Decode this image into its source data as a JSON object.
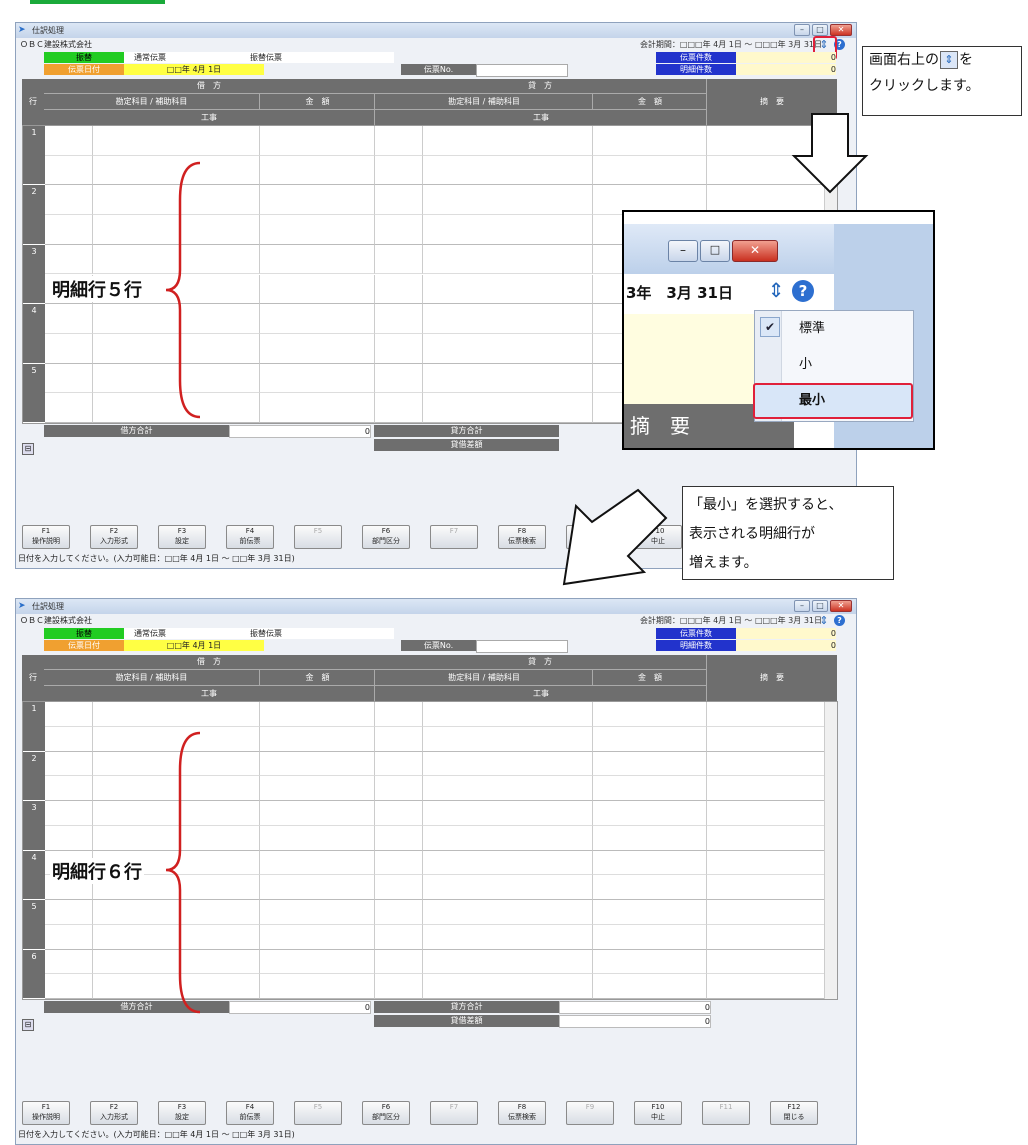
{
  "window": {
    "title": "仕訳処理",
    "company": "ＯＢＣ建設株式会社",
    "period": "会計期間：□□□年 4月 1日 ～ □□□年 3月 31日",
    "header": {
      "kind_label": "振替",
      "slip_type": "通常伝票",
      "transfer_slip": "振替伝票",
      "date_label": "伝票日付",
      "date_value": "□□年 4月 1日",
      "slip_no_label": "伝票No.",
      "slip_count_label": "伝票件数",
      "slip_count_value": "0",
      "detail_count_label": "明細件数",
      "detail_count_value": "0"
    },
    "columns": {
      "row": "行",
      "debit": "借　方",
      "credit": "貸　方",
      "account": "勘定科目 / 補助科目",
      "amount": "金　額",
      "project": "工事",
      "memo": "摘　要"
    },
    "totals": {
      "debit_total": "借方合計",
      "credit_total": "貸方合計",
      "difference": "貸借差額",
      "value": "0"
    },
    "fkeys": [
      {
        "key": "F1",
        "label": "操作説明",
        "enabled": true
      },
      {
        "key": "F2",
        "label": "入力形式",
        "enabled": true
      },
      {
        "key": "F3",
        "label": "設定",
        "enabled": true
      },
      {
        "key": "F4",
        "label": "前伝票",
        "enabled": true
      },
      {
        "key": "F5",
        "label": "",
        "enabled": false
      },
      {
        "key": "F6",
        "label": "部門区分",
        "enabled": true
      },
      {
        "key": "F7",
        "label": "",
        "enabled": false
      },
      {
        "key": "F8",
        "label": "伝票検索",
        "enabled": true
      },
      {
        "key": "F9",
        "label": "",
        "enabled": false
      },
      {
        "key": "F10",
        "label": "中止",
        "enabled": true
      },
      {
        "key": "F11",
        "label": "",
        "enabled": false
      },
      {
        "key": "F12",
        "label": "閉じる",
        "enabled": true
      }
    ],
    "status": "日付を入力してください。(入力可能日：□□年 4月 1日 ～ □□年 3月 31日)"
  },
  "top": {
    "rows": [
      "1",
      "2",
      "3",
      "4",
      "5"
    ],
    "annotation": "明細行５行"
  },
  "bottom": {
    "rows": [
      "1",
      "2",
      "3",
      "4",
      "5",
      "6"
    ],
    "annotation": "明細行６行"
  },
  "callout_top": [
    "画面右上の",
    "をクリックします。"
  ],
  "callout_bottom": [
    "「最小」を選択すると、",
    "表示される明細行が",
    "増えます。"
  ],
  "popup": {
    "date": "3年　3月 31日",
    "memo": "摘　要",
    "items": [
      {
        "label": "標準",
        "checked": true
      },
      {
        "label": "小",
        "checked": false
      },
      {
        "label": "最小",
        "checked": false
      }
    ]
  },
  "colors": {
    "accent": "#e0203a",
    "header_green": "#22cc22",
    "header_orange": "#f0a030",
    "header_blue": "#2233cc",
    "date_yellow": "#ffff44"
  }
}
